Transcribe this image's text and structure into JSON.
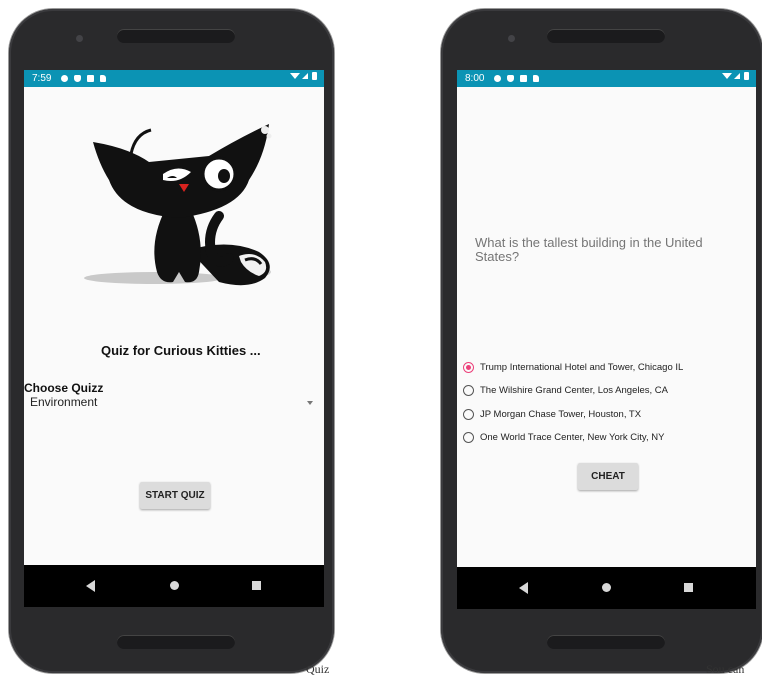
{
  "left_screen": {
    "status_time": "7:59",
    "app_title": "Quiz for Curious Kitties ...",
    "choose_label": "Choose Quizz",
    "spinner_value": "Environment",
    "start_button": "START QUIZ"
  },
  "right_screen": {
    "status_time": "8:00",
    "question": "What is the tallest building in the United States?",
    "options": [
      "Trump International Hotel and Tower, Chicago IL",
      "The Wilshire Grand Center, Los Angeles, CA",
      "JP Morgan Chase Tower, Houston, TX",
      "One World Trace Center, New York City, NY"
    ],
    "selected_option": 0,
    "cheat_button": "CHEAT"
  },
  "captions": {
    "left": "Quiz",
    "right": "Sou can"
  },
  "colors": {
    "status_bar": "#0b93b4",
    "radio_accent": "#ec407a",
    "phone_body": "#2a2a2c"
  }
}
